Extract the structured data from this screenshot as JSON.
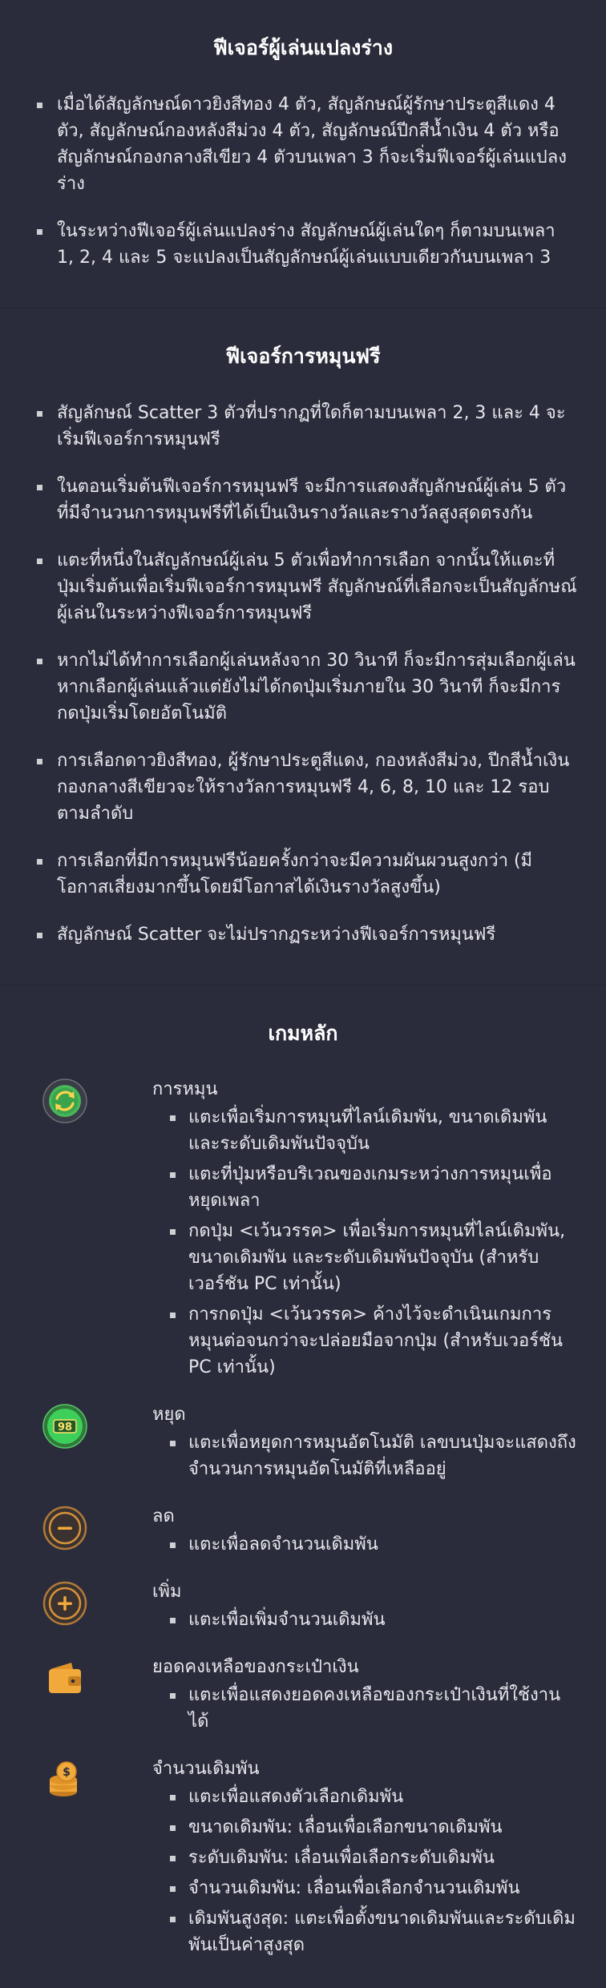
{
  "transform": {
    "title": "ฟีเจอร์ผู้เล่นแปลงร่าง",
    "items": [
      "เมื่อได้สัญลักษณ์ดาวยิงสีทอง 4 ตัว, สัญลักษณ์ผู้รักษาประตูสีแดง 4 ตัว, สัญลักษณ์กองหลังสีม่วง 4 ตัว, สัญลักษณ์ปีกสีน้ำเงิน 4 ตัว หรือ สัญลักษณ์กองกลางสีเขียว 4 ตัวบนเพลา 3 ก็จะเริ่มฟีเจอร์ผู้เล่นแปลงร่าง",
      "ในระหว่างฟีเจอร์ผู้เล่นแปลงร่าง สัญลักษณ์ผู้เล่นใดๆ ก็ตามบนเพลา 1, 2, 4 และ 5 จะแปลงเป็นสัญลักษณ์ผู้เล่นแบบเดียวกันบนเพลา 3"
    ]
  },
  "freespin": {
    "title": "ฟีเจอร์การหมุนฟรี",
    "items": [
      "สัญลักษณ์ Scatter 3 ตัวที่ปรากฏที่ใดก็ตามบนเพลา 2, 3 และ 4 จะเริ่มฟีเจอร์การหมุนฟรี",
      "ในตอนเริ่มต้นฟีเจอร์การหมุนฟรี จะมีการแสดงสัญลักษณ์ผู้เล่น 5 ตัว ที่มีจำนวนการหมุนฟรีที่ได้เป็นเงินรางวัลและรางวัลสูงสุดตรงกัน",
      "แตะที่หนึ่งในสัญลักษณ์ผู้เล่น 5 ตัวเพื่อทำการเลือก จากนั้นให้แตะที่ปุ่มเริ่มต้นเพื่อเริ่มฟีเจอร์การหมุนฟรี สัญลักษณ์ที่เลือกจะเป็นสัญลักษณ์ผู้เล่นในระหว่างฟีเจอร์การหมุนฟรี",
      "หากไม่ได้ทำการเลือกผู้เล่นหลังจาก 30 วินาที ก็จะมีการสุ่มเลือกผู้เล่น หากเลือกผู้เล่นแล้วแต่ยังไม่ได้กดปุ่มเริ่มภายใน 30 วินาที ก็จะมีการกดปุ่มเริ่มโดยอัตโนมัติ",
      "การเลือกดาวยิงสีทอง, ผู้รักษาประตูสีแดง, กองหลังสีม่วง, ปีกสีน้ำเงิน กองกลางสีเขียวจะให้รางวัลการหมุนฟรี 4, 6, 8, 10 และ 12 รอบ ตามลำดับ",
      "การเลือกที่มีการหมุนฟรีน้อยครั้งกว่าจะมีความผันผวนสูงกว่า (มีโอกาสเสี่ยงมากขึ้นโดยมีโอกาสได้เงินรางวัลสูงขึ้น)",
      "สัญลักษณ์ Scatter จะไม่ปรากฏระหว่างฟีเจอร์การหมุนฟรี"
    ]
  },
  "main": {
    "title": "เกมหลัก",
    "spin": {
      "icon": "spin-icon",
      "label": "การหมุน",
      "items": [
        "แตะเพื่อเริ่มการหมุนที่ไลน์เดิมพัน, ขนาดเดิมพัน และระดับเดิมพันปัจจุบัน",
        "แตะที่ปุ่มหรือบริเวณของเกมระหว่างการหมุนเพื่อหยุดเพลา",
        "กดปุ่ม <เว้นวรรค> เพื่อเริ่มการหมุนที่ไลน์เดิมพัน, ขนาดเดิมพัน และระดับเดิมพันปัจจุบัน (สำหรับเวอร์ชัน PC เท่านั้น)",
        "การกดปุ่ม <เว้นวรรค> ค้างไว้จะดำเนินเกมการหมุนต่อจนกว่าจะปล่อยมือจากปุ่ม (สำหรับเวอร์ชัน PC เท่านั้น)"
      ]
    },
    "stop": {
      "icon": "autospin-stop-icon",
      "badge": "98",
      "label": "หยุด",
      "items": [
        "แตะเพื่อหยุดการหมุนอัตโนมัติ เลขบนปุ่มจะแสดงถึงจำนวนการหมุนอัตโนมัติที่เหลืออยู่"
      ]
    },
    "decrease": {
      "icon": "minus-icon",
      "label": "ลด",
      "items": [
        "แตะเพื่อลดจำนวนเดิมพัน"
      ]
    },
    "increase": {
      "icon": "plus-icon",
      "label": "เพิ่ม",
      "items": [
        "แตะเพื่อเพิ่มจำนวนเดิมพัน"
      ]
    },
    "wallet": {
      "icon": "wallet-icon",
      "label": "ยอดคงเหลือของกระเป๋าเงิน",
      "items": [
        "แตะเพื่อแสดงยอดคงเหลือของกระเป๋าเงินที่ใช้งานได้"
      ]
    },
    "bet": {
      "icon": "coins-icon",
      "label": "จำนวนเดิมพัน",
      "items": [
        "แตะเพื่อแสดงตัวเลือกเดิมพัน",
        "ขนาดเดิมพัน: เลื่อนเพื่อเลือกขนาดเดิมพัน",
        "ระดับเดิมพัน: เลื่อนเพื่อเลือกระดับเดิมพัน",
        "จำนวนเดิมพัน: เลื่อนเพื่อเลือกจำนวนเดิมพัน",
        "เดิมพันสูงสุด: แตะเพื่อตั้งขนาดเดิมพันและระดับเดิมพันเป็นค่าสูงสุด"
      ]
    }
  },
  "colors": {
    "background": "#2b2c3b",
    "accent_gold": "#f2a93b",
    "accent_green": "#3ecf5a"
  }
}
